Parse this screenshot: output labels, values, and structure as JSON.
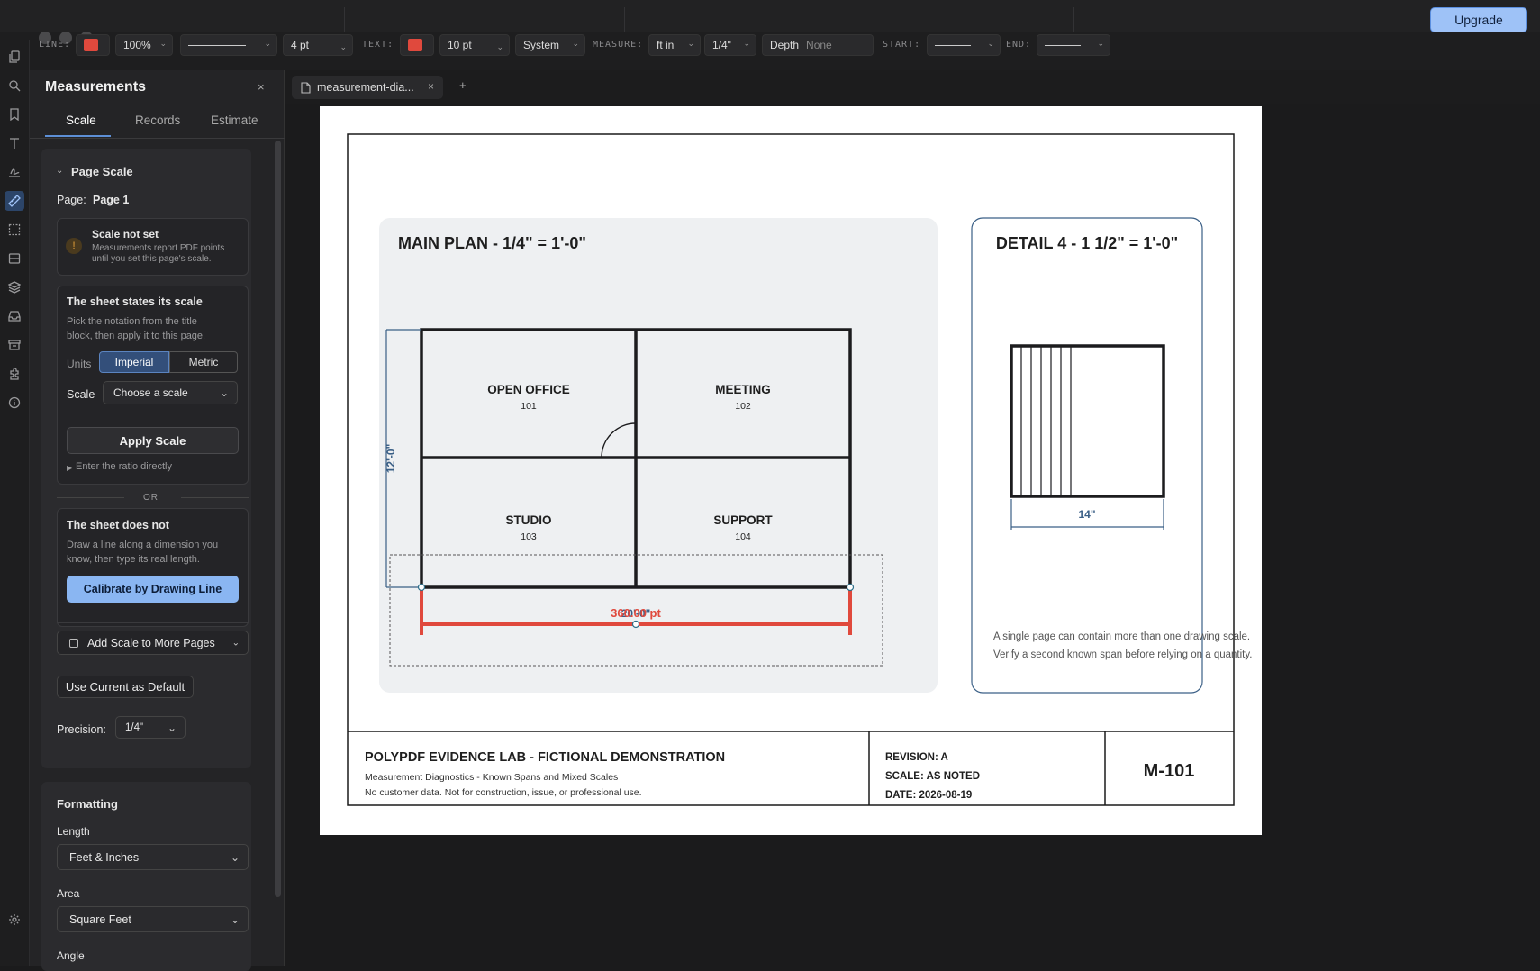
{
  "topbar": {
    "upgrade": "Upgrade"
  },
  "toolbar": {
    "line_label": "LINE:",
    "line_color": "#e0493d",
    "opacity": "100%",
    "line_width": "4 pt",
    "text_label": "TEXT:",
    "text_color": "#e0493d",
    "font_size": "10 pt",
    "font": "System",
    "measure_label": "MEASURE:",
    "unit": "ft in",
    "precision": "1/4\"",
    "depth_label": "Depth",
    "depth_value": "None",
    "start_label": "START:",
    "end_label": "END:"
  },
  "rail": {
    "icons": [
      "pages-icon",
      "search-icon",
      "bookmark-icon",
      "text-tool-icon",
      "signature-icon",
      "measure-ruler-icon",
      "select-rect-icon",
      "form-icon",
      "layers-icon",
      "inbox-icon",
      "archive-icon",
      "plugins-icon",
      "info-icon"
    ],
    "settings_icon": "gear-icon"
  },
  "panel": {
    "title": "Measurements",
    "tabs": [
      "Scale",
      "Records",
      "Estimate"
    ],
    "active_tab": "Scale",
    "page_scale_header": "Page Scale",
    "page_label": "Page:",
    "page_value": "Page 1",
    "warning_title": "Scale not set",
    "warning_text1": "Measurements report PDF points",
    "warning_text2": "until you set this page's scale.",
    "states_title": "The sheet states its scale",
    "states_desc1": "Pick the notation from the title",
    "states_desc2": "block, then apply it to this page.",
    "units_label": "Units",
    "units_options": [
      "Imperial",
      "Metric"
    ],
    "units_selected": "Imperial",
    "scale_label": "Scale",
    "scale_placeholder": "Choose a scale",
    "apply_button": "Apply Scale",
    "ratio_link": "Enter the ratio directly",
    "or_divider": "OR",
    "not_title": "The sheet does not",
    "not_desc1": "Draw a line along a dimension you",
    "not_desc2": "know, then type its real length.",
    "calibrate_button": "Calibrate by Drawing Line",
    "add_scale_button": "Add Scale to More Pages",
    "default_button": "Use Current as Default",
    "precision_label": "Precision:",
    "precision_value": "1/4\"",
    "formatting_title": "Formatting",
    "length_label": "Length",
    "length_value": "Feet & Inches",
    "area_label": "Area",
    "area_value": "Square Feet",
    "angle_label": "Angle"
  },
  "document": {
    "tab_name": "measurement-dia...",
    "add_tab": "+"
  },
  "drawing": {
    "main_title": "MAIN PLAN - 1/4\" = 1'-0\"",
    "detail_title": "DETAIL 4 - 1 1/2\" = 1'-0\"",
    "rooms": [
      {
        "name": "OPEN OFFICE",
        "number": "101"
      },
      {
        "name": "MEETING",
        "number": "102"
      },
      {
        "name": "STUDIO",
        "number": "103"
      },
      {
        "name": "SUPPORT",
        "number": "104"
      }
    ],
    "dim_vertical": "12'-0\"",
    "dim_horizontal": "20'-0\"",
    "measurement_value": "360.00 pt",
    "detail_dim": "14\"",
    "note1": "A single page can contain more than one drawing scale.",
    "note2": "Verify a second known span before relying on a quantity.",
    "title_block": {
      "project": "POLYPDF EVIDENCE LAB - FICTIONAL DEMONSTRATION",
      "subtitle": "Measurement Diagnostics - Known Spans and Mixed Scales",
      "disclaimer": "No customer data. Not for construction, issue, or professional use.",
      "revision": "REVISION: A",
      "scale": "SCALE: AS NOTED",
      "date": "DATE: 2026-08-19",
      "sheet": "M-101"
    }
  }
}
